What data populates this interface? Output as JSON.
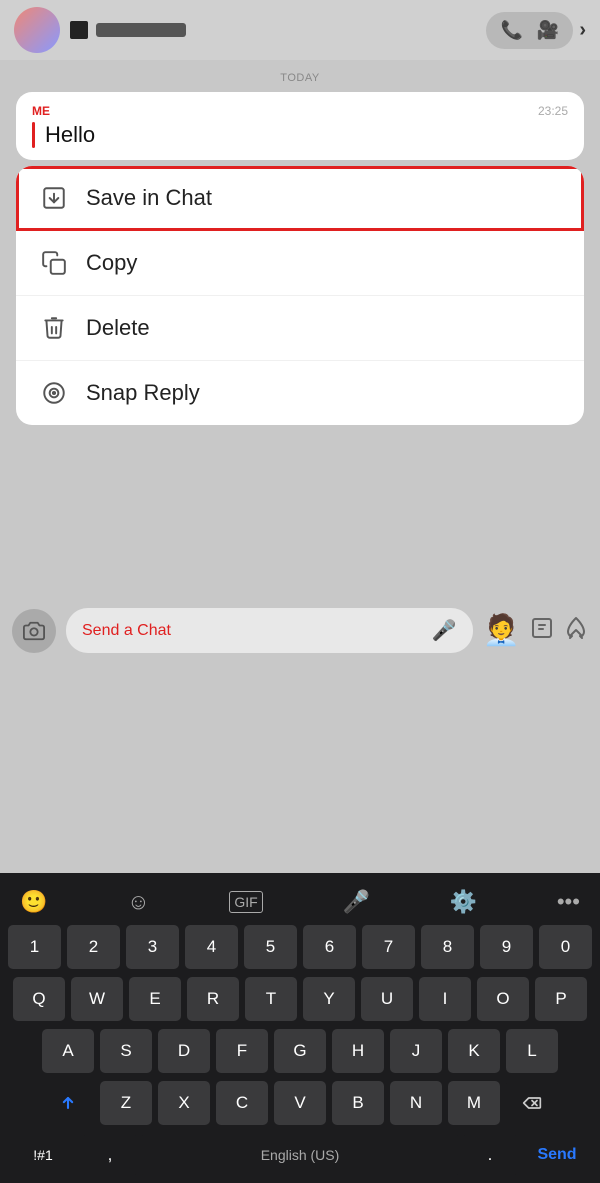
{
  "header": {
    "call_icon": "📞",
    "video_icon": "📹",
    "chevron_icon": "›"
  },
  "chat": {
    "today_label": "TODAY",
    "message": {
      "sender": "ME",
      "time": "23:25",
      "text": "Hello"
    }
  },
  "context_menu": {
    "items": [
      {
        "id": "save-in-chat",
        "label": "Save in Chat",
        "highlighted": true
      },
      {
        "id": "copy",
        "label": "Copy",
        "highlighted": false
      },
      {
        "id": "delete",
        "label": "Delete",
        "highlighted": false
      },
      {
        "id": "snap-reply",
        "label": "Snap Reply",
        "highlighted": false
      }
    ]
  },
  "input_bar": {
    "placeholder": "Send a Chat"
  },
  "keyboard": {
    "numbers": [
      "1",
      "2",
      "3",
      "4",
      "5",
      "6",
      "7",
      "8",
      "9",
      "0"
    ],
    "row1": [
      "Q",
      "W",
      "E",
      "R",
      "T",
      "Y",
      "U",
      "I",
      "O",
      "P"
    ],
    "row2": [
      "A",
      "S",
      "D",
      "F",
      "G",
      "H",
      "J",
      "K",
      "L"
    ],
    "row3": [
      "Z",
      "X",
      "C",
      "V",
      "B",
      "N",
      "M"
    ],
    "special_left": "!#1",
    "space": "English (US)",
    "period": ".",
    "send": "Send"
  }
}
